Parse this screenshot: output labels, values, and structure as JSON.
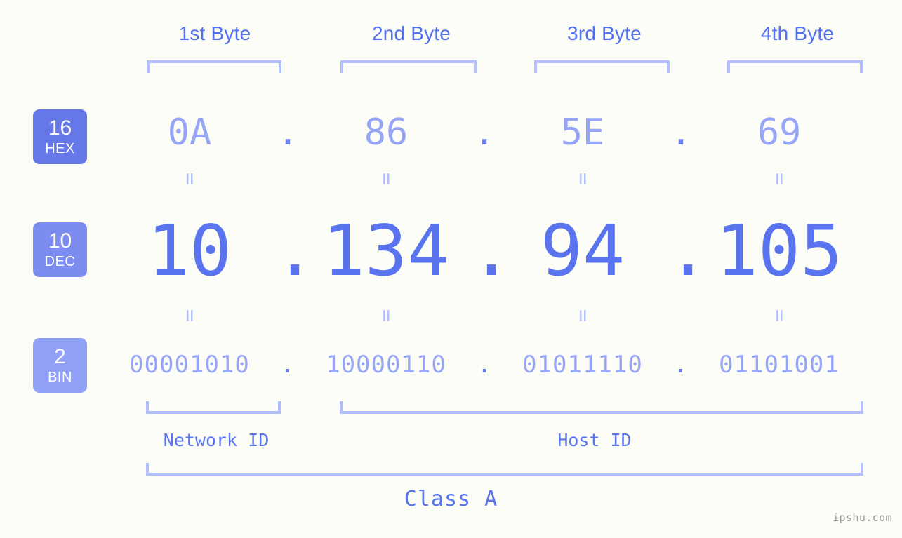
{
  "background_color": "#fcfdf7",
  "accent_color": "#5a74f0",
  "accent_light_color": "#97a5f7",
  "bracket_color": "#b3befc",
  "header": {
    "byte_labels": [
      {
        "label": "1st Byte"
      },
      {
        "label": "2nd Byte"
      },
      {
        "label": "3rd Byte"
      },
      {
        "label": "4th Byte"
      }
    ]
  },
  "bases": {
    "hex": {
      "number": "16",
      "name": "HEX",
      "color": "#6678e8"
    },
    "dec": {
      "number": "10",
      "name": "DEC",
      "color": "#7c8cf0"
    },
    "bin": {
      "number": "2",
      "name": "BIN",
      "color": "#92a1f8"
    }
  },
  "separator": ".",
  "equals_mark": "=",
  "rows": {
    "hex": {
      "base_label": "HEX",
      "octets": [
        "0A",
        "86",
        "5E",
        "69"
      ],
      "joined": "0A.86.5E.69"
    },
    "dec": {
      "base_label": "DEC",
      "octets": [
        "10",
        "134",
        "94",
        "105"
      ],
      "joined": "10.134.94.105"
    },
    "bin": {
      "base_label": "BIN",
      "octets": [
        "00001010",
        "10000110",
        "01011110",
        "01101001"
      ],
      "joined": "00001010.10000110.01011110.01101001"
    }
  },
  "footer": {
    "network_id_label": "Network ID",
    "host_id_label": "Host ID",
    "class_label": "Class A",
    "watermark": "ipshu.com"
  }
}
